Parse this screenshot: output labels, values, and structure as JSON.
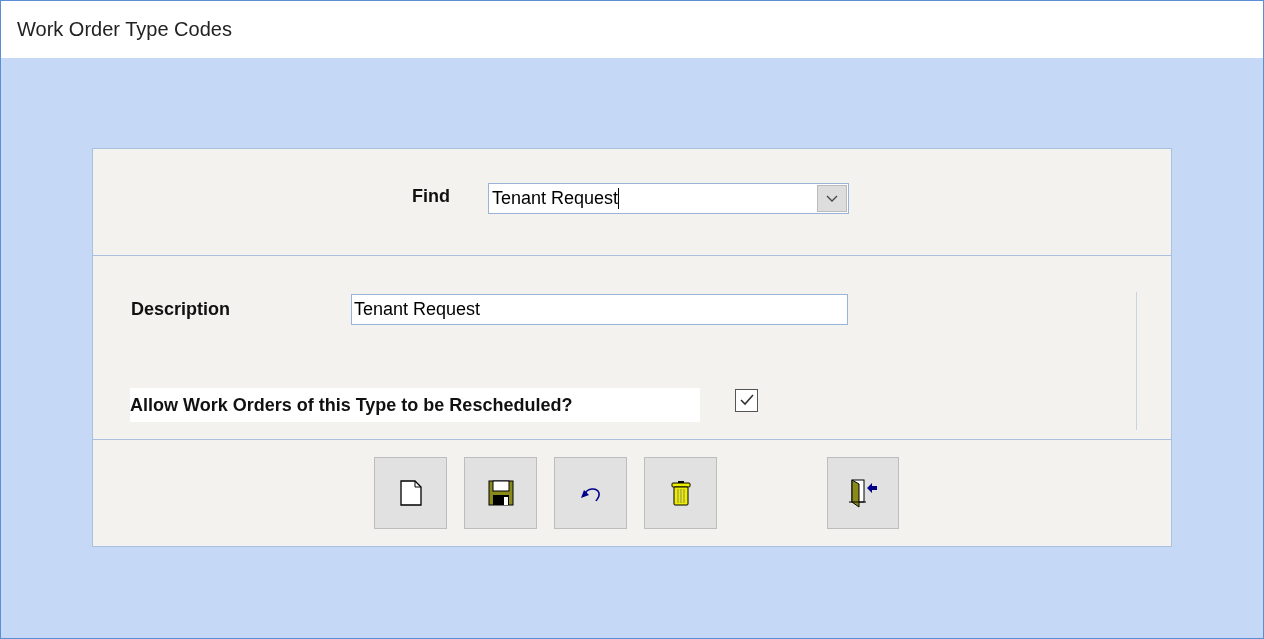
{
  "window": {
    "title": "Work Order Type Codes"
  },
  "find": {
    "label": "Find",
    "value": "Tenant Request"
  },
  "description": {
    "label": "Description",
    "value": "Tenant Request"
  },
  "reschedule": {
    "label": "Allow Work Orders of this Type to be Rescheduled?",
    "checked": true
  },
  "buttons": [
    {
      "kind": "new"
    },
    {
      "kind": "save"
    },
    {
      "kind": "undo"
    },
    {
      "kind": "delete"
    },
    {
      "kind": "exit"
    }
  ]
}
